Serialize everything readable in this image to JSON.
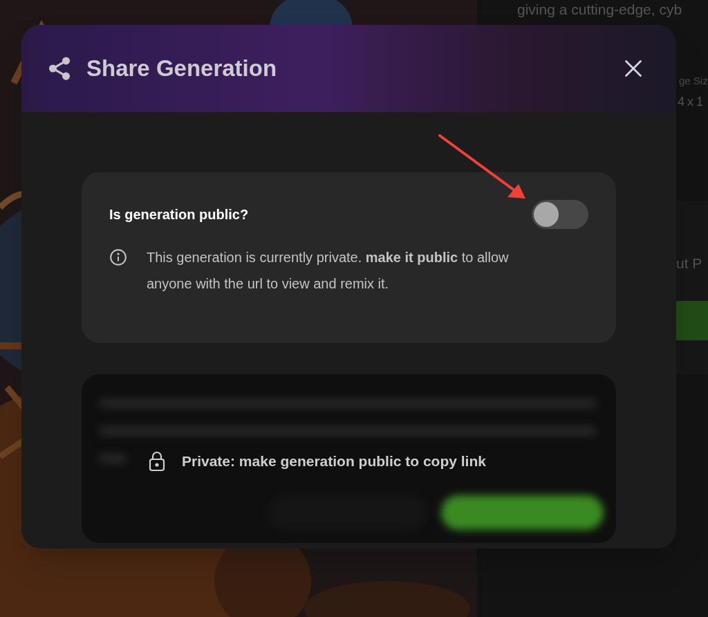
{
  "background": {
    "description_fragment": "giving a cutting-edge, cyb",
    "field_label_fragment": "ge Siz",
    "field_value_fragment": "4 x 1",
    "section_fragment": "ut P"
  },
  "dialog": {
    "title": "Share Generation",
    "public_setting": {
      "label": "Is generation public?",
      "on": false,
      "info": "This generation is currently private. **make it public** to allow anyone with the url to view and remix it."
    },
    "link_notice": "Private: make generation public to copy link"
  }
}
